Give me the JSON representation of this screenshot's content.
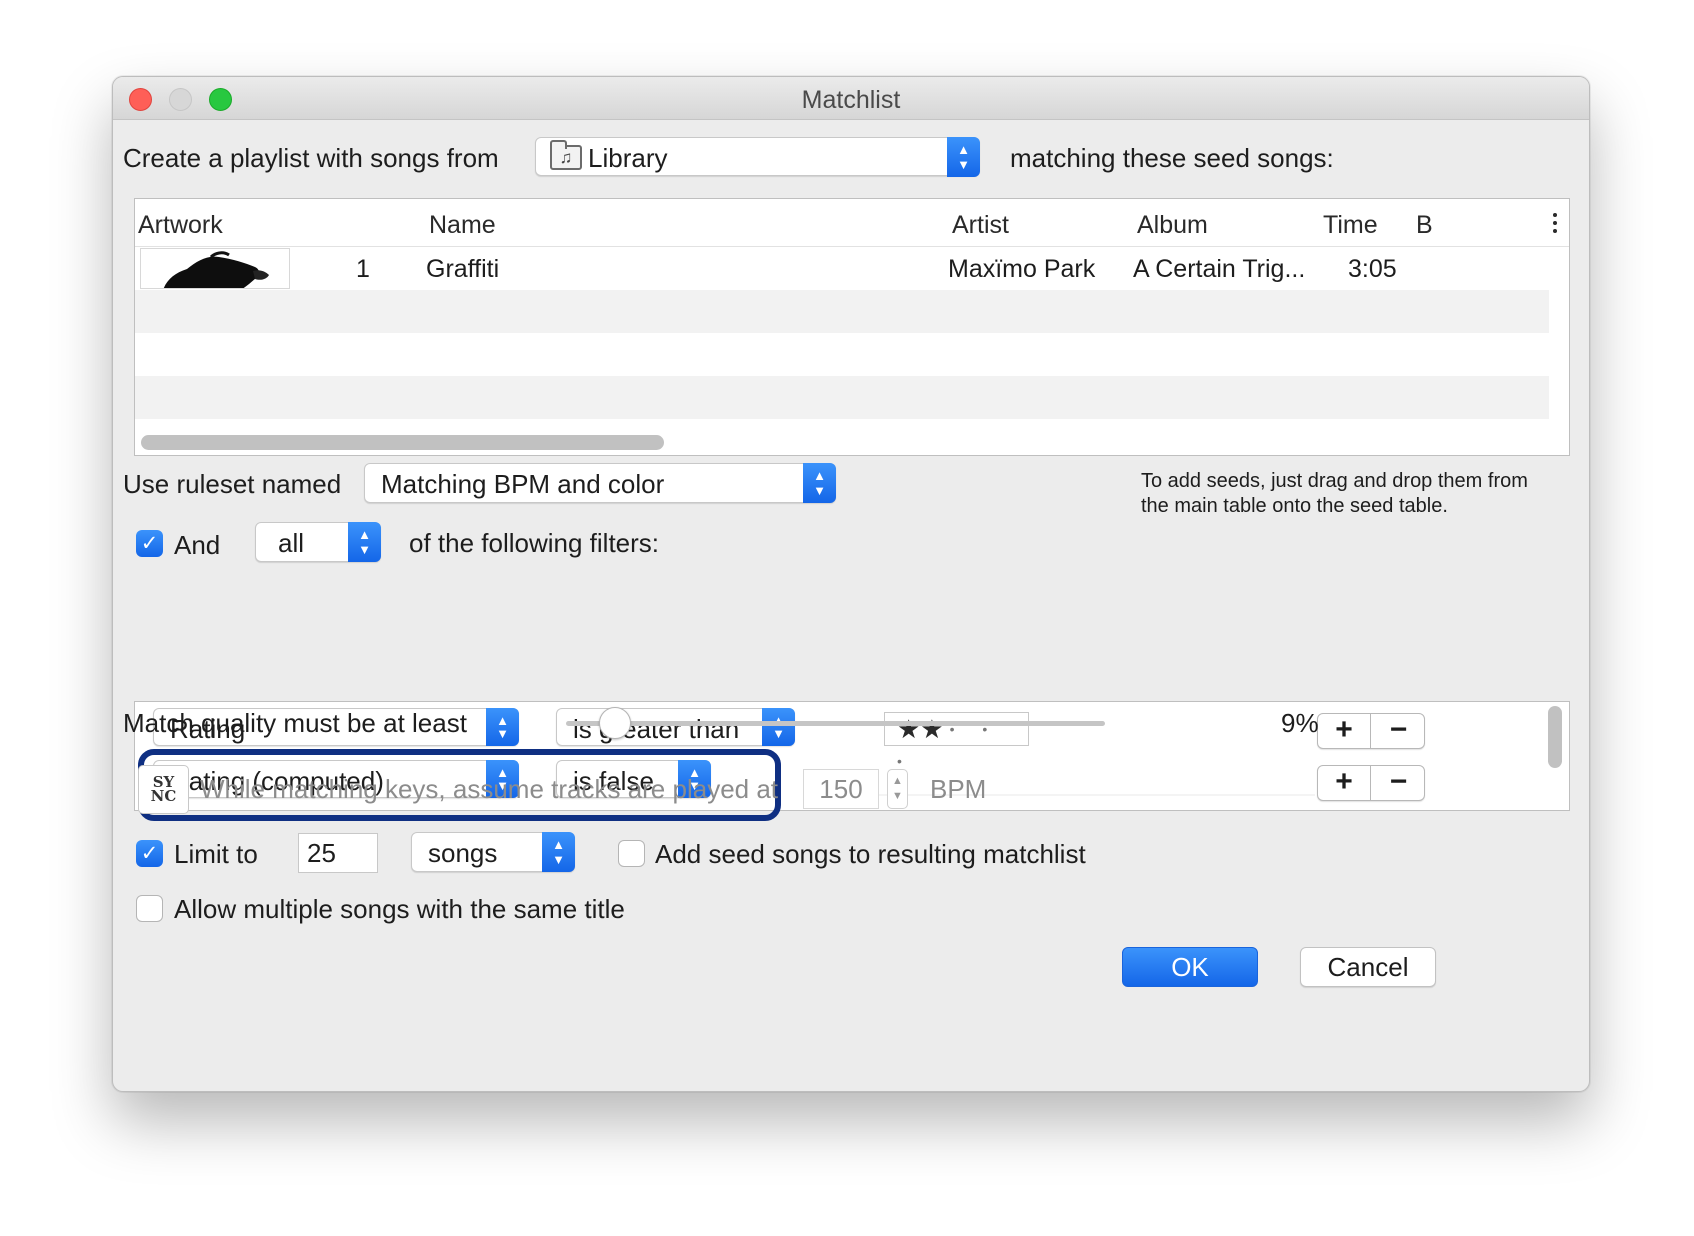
{
  "window": {
    "title": "Matchlist"
  },
  "source": {
    "prefix": "Create a playlist with songs from",
    "selected": "Library",
    "suffix": "matching these seed songs:"
  },
  "seed_table": {
    "columns": [
      "Artwork",
      "Name",
      "Artist",
      "Album",
      "Time",
      "B"
    ],
    "rows": [
      {
        "index": "1",
        "name": "Graffiti",
        "artist": "Maxïmo Park",
        "album": "A Certain Trig...",
        "time": "3:05"
      }
    ]
  },
  "ruleset": {
    "label": "Use ruleset named",
    "selected": "Matching BPM and color",
    "hint_line1": "To add seeds, just drag and drop them from",
    "hint_line2": "the main table onto the seed table."
  },
  "filter_mode": {
    "checkbox_label": "And",
    "checked": true,
    "quantifier": "all",
    "suffix": "of the following filters:"
  },
  "filters": [
    {
      "field": "Rating",
      "operator": "is greater than",
      "stars": "★★",
      "star_dots": "• • •",
      "star_value": 2
    },
    {
      "field": "Rating (computed)",
      "operator": "is false"
    }
  ],
  "match_quality": {
    "label": "Match quality must be at least",
    "value_text": "9%",
    "value": 0.09
  },
  "key_matching": {
    "icon_top": "SY",
    "icon_bottom": "NC",
    "label": "While matching keys, assume tracks are played at",
    "bpm": "150",
    "unit": "BPM"
  },
  "limit": {
    "checkbox_label": "Limit to",
    "checked": true,
    "count": "25",
    "unit": "songs"
  },
  "add_seeds": {
    "label": "Add seed songs to resulting matchlist",
    "checked": false
  },
  "allow_duplicates": {
    "label": "Allow multiple songs with the same title",
    "checked": false
  },
  "buttons": {
    "ok": "OK",
    "cancel": "Cancel"
  },
  "colors": {
    "accent": "#1a6ff0",
    "highlight_border": "#0f2f82",
    "close": "#fe5f57",
    "zoom": "#28c840"
  }
}
